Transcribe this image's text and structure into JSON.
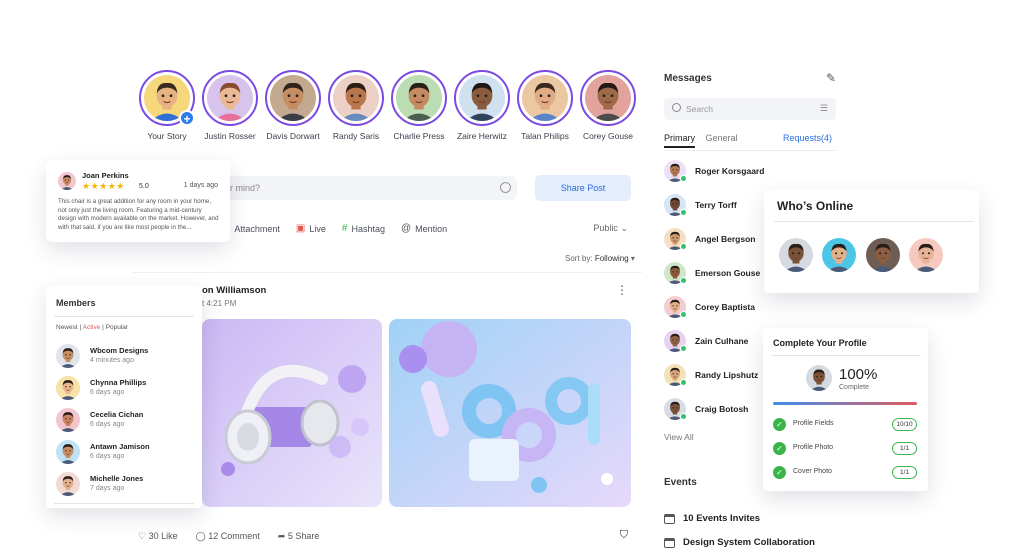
{
  "colors": {
    "accent": "#2b6ddc",
    "ring": "#7b4ae2",
    "online": "#34c36b",
    "star": "#f4b400",
    "check": "#3bb54a"
  },
  "stories": [
    {
      "name": "Your Story",
      "bg": "#f6d77c",
      "skin": "#e8b383",
      "hair": "#3a2a20",
      "shirt": "#2f6fd6"
    },
    {
      "name": "Justin Rosser",
      "bg": "#d8c3ec",
      "skin": "#e9b895",
      "hair": "#8a4a2e",
      "shirt": "#e8709c"
    },
    {
      "name": "Davis Dorwart",
      "bg": "#c2a98f",
      "skin": "#c58d61",
      "hair": "#2f221b",
      "shirt": "#3c3d45"
    },
    {
      "name": "Randy Saris",
      "bg": "#ecd0c6",
      "skin": "#b9764b",
      "hair": "#2b1d16",
      "shirt": "#6a8bbf"
    },
    {
      "name": "Charlie Press",
      "bg": "#bcdcb3",
      "skin": "#c48b62",
      "hair": "#2a1f18",
      "shirt": "#4c5f4f"
    },
    {
      "name": "Zaire Herwitz",
      "bg": "#cfe0ef",
      "skin": "#8a5c3e",
      "hair": "#1f1713",
      "shirt": "#30425e"
    },
    {
      "name": "Talan Philips",
      "bg": "#ecc8a2",
      "skin": "#e1ab83",
      "hair": "#3b2a1f",
      "shirt": "#5b83c9"
    },
    {
      "name": "Corey Gouse",
      "bg": "#e3a39d",
      "skin": "#9d6b4a",
      "hair": "#221914",
      "shirt": "#4c4c4c"
    }
  ],
  "composer": {
    "placeholder": "r mind?",
    "share_label": "Share Post",
    "actions": [
      "Attachment",
      "Live",
      "Hashtag",
      "Mention"
    ],
    "visibility": "Public"
  },
  "sort": {
    "label": "Sort by:",
    "value": "Following"
  },
  "post": {
    "author": "on Williamson",
    "time": "t 4:21 PM",
    "likes": "30 Like",
    "comments": "12 Comment",
    "shares": "5 Share"
  },
  "messages": {
    "title": "Messages",
    "search_placeholder": "Search",
    "tabs": {
      "primary": "Primary",
      "general": "General",
      "requests": "Requests(4)"
    },
    "contacts": [
      {
        "name": "Roger Korsgaard",
        "skin": "#b47a55",
        "bg": "#ece0f7"
      },
      {
        "name": "Terry Torff",
        "skin": "#6e4a32",
        "bg": "#d6e6f4"
      },
      {
        "name": "Angel Bergson",
        "skin": "#d09a6f",
        "bg": "#f5dfc3"
      },
      {
        "name": "Emerson Gouse",
        "skin": "#8c5b3d",
        "bg": "#cfe7c9"
      },
      {
        "name": "Corey Baptista",
        "skin": "#e2b08a",
        "bg": "#f3cdd1"
      },
      {
        "name": "Zain Culhane",
        "skin": "#8e6244",
        "bg": "#e7d3f0"
      },
      {
        "name": "Randy Lipshutz",
        "skin": "#d9a57d",
        "bg": "#f3e2b8"
      },
      {
        "name": "Craig Botosh",
        "skin": "#7b523a",
        "bg": "#d8dde5"
      }
    ],
    "view_all": "View All"
  },
  "events": {
    "title": "Events",
    "items": [
      "10 Events Invites",
      "Design System Collaboration"
    ]
  },
  "review": {
    "name": "Joan Perkins",
    "stars": "★★★★★",
    "rating": "5.0",
    "time": "1 days ago",
    "text": "This chair is a great addition for any room in your home, not only just the living room. Featuring a mid-century design with modern available on the market. However, and with that said, if you are like most people in the..."
  },
  "members": {
    "title": "Members",
    "filters": {
      "newest": "Newest",
      "active": "Active",
      "popular": "Popular",
      "sep": "|"
    },
    "items": [
      {
        "name": "Wbcom Designs",
        "time": "4 minutes ago",
        "skin": "#c68f68",
        "bg": "#dfe3ea"
      },
      {
        "name": "Chynna Phillips",
        "time": "6 days ago",
        "skin": "#e9b68e",
        "bg": "#f7e3a8"
      },
      {
        "name": "Cecelia Cichan",
        "time": "6 days ago",
        "skin": "#c98563",
        "bg": "#f2c6cf"
      },
      {
        "name": "Antawn Jamison",
        "time": "6 days ago",
        "skin": "#c48f68",
        "bg": "#bfe2f4"
      },
      {
        "name": "Michelle Jones",
        "time": "7 days ago",
        "skin": "#e4b08f",
        "bg": "#f1dad3"
      }
    ]
  },
  "online": {
    "title": "Who’s Online",
    "people": [
      {
        "skin": "#7a5238",
        "bg": "#d5d9e0"
      },
      {
        "skin": "#e3b089",
        "bg": "#4cc6e6"
      },
      {
        "skin": "#8b5e42",
        "bg": "#6d5d52"
      },
      {
        "skin": "#e9b496",
        "bg": "#f6c9c0"
      }
    ]
  },
  "profile": {
    "title": "Complete Your Profile",
    "percent": "100%",
    "completion": 1.0,
    "label": "Complete",
    "rows": [
      {
        "label": "Profile Fields",
        "value": "10/10"
      },
      {
        "label": "Profile Photo",
        "value": "1/1"
      },
      {
        "label": "Cover Photo",
        "value": "1/1"
      }
    ]
  }
}
